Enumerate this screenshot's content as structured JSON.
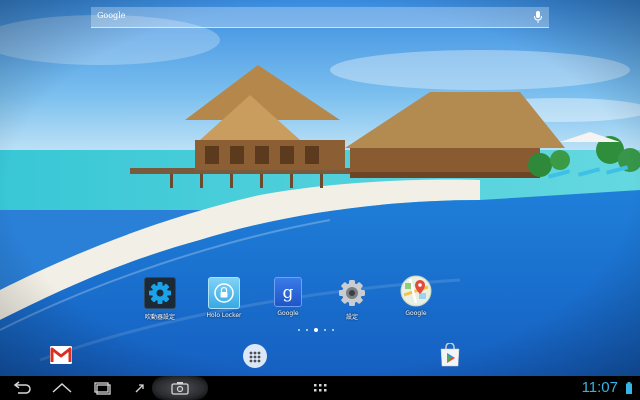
{
  "search": {
    "placeholder_text": "Google",
    "icon": "mic-icon"
  },
  "apps": [
    {
      "label": "吹動器設定",
      "icon": "gear-icon"
    },
    {
      "label": "Holo Locker",
      "icon": "lock-icon"
    },
    {
      "label": "Google",
      "icon": "google-g-icon"
    },
    {
      "label": "設定",
      "icon": "settings-icon"
    },
    {
      "label": "Google",
      "icon": "maps-icon"
    }
  ],
  "page_indicator": {
    "count": 5,
    "current": 3
  },
  "dock": [
    {
      "name": "gmail-icon"
    },
    {
      "name": "app-drawer-icon"
    },
    {
      "name": "play-store-icon"
    }
  ],
  "navbar": {
    "buttons": [
      "back-icon",
      "home-icon",
      "recents-icon",
      "expand-icon",
      "screenshot-icon",
      "menu-icon"
    ],
    "clock": "11:07",
    "clock_color": "#33b5e5"
  }
}
